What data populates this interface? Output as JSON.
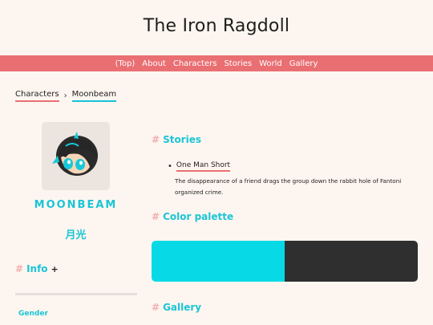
{
  "site": {
    "title": "The Iron Ragdoll"
  },
  "nav": {
    "items": [
      {
        "label": "(Top)"
      },
      {
        "label": "About"
      },
      {
        "label": "Characters"
      },
      {
        "label": "Stories"
      },
      {
        "label": "World"
      },
      {
        "label": "Gallery"
      }
    ]
  },
  "breadcrumb": {
    "items": [
      {
        "label": "Characters"
      },
      {
        "label": "Moonbeam"
      }
    ],
    "separator": "›"
  },
  "character": {
    "name": "MOONBEAM",
    "name_jp": "月光"
  },
  "sidebar": {
    "info_heading": "Info",
    "expand_label": "+",
    "gender_label": "Gender"
  },
  "sections": {
    "hash": "#",
    "stories_heading": "Stories",
    "palette_heading": "Color palette",
    "gallery_heading": "Gallery"
  },
  "stories": [
    {
      "title": "One Man Short",
      "description": "The disappearance of a friend drags the group down the rabbit hole of Fantoni organized crime."
    }
  ],
  "palette": {
    "colors": [
      "#08d9e6",
      "#2f2f2f"
    ]
  },
  "colors": {
    "accent_pink": "#e96f73",
    "accent_cyan": "#1bc5d6"
  }
}
